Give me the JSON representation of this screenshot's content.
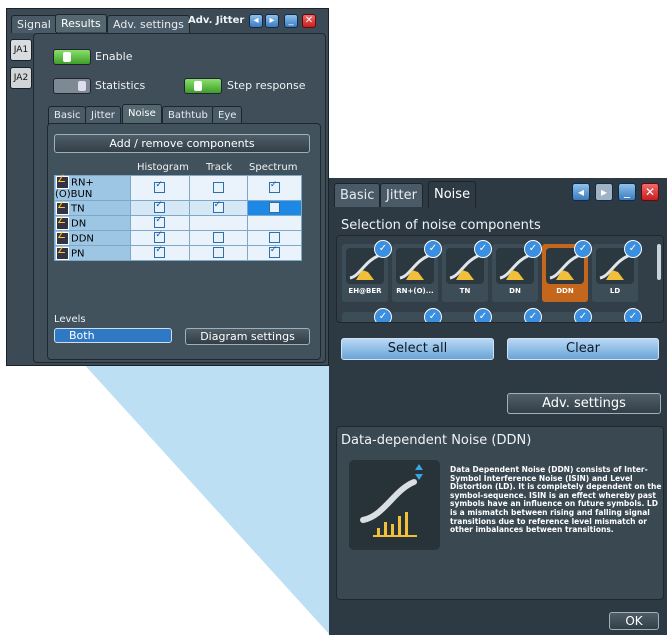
{
  "window": {
    "title": "Adv. Jitter",
    "tabs": [
      "Signal",
      "Results",
      "Adv. settings"
    ],
    "side_tabs": [
      "JA1",
      "JA2"
    ],
    "enable_label": "Enable",
    "statistics_label": "Statistics",
    "step_response_label": "Step response",
    "enable_state": "on",
    "statistics_state": "off",
    "step_response_state": "on",
    "sub_tabs": [
      "Basic",
      "Jitter",
      "Noise",
      "Bathtub",
      "Eye"
    ],
    "add_remove_label": "Add / remove components",
    "columns": [
      "Histogram",
      "Track",
      "Spectrum"
    ],
    "rows": [
      {
        "name": "RN+(O)BUN",
        "histogram": true,
        "track": false,
        "spectrum": true
      },
      {
        "name": "TN",
        "histogram": true,
        "track": true,
        "spectrum": false
      },
      {
        "name": "DN",
        "histogram": true,
        "track": null,
        "spectrum": null
      },
      {
        "name": "DDN",
        "histogram": true,
        "track": false,
        "spectrum": false
      },
      {
        "name": "PN",
        "histogram": true,
        "track": false,
        "spectrum": true
      }
    ],
    "levels_label": "Levels",
    "levels_value": "Both",
    "diagram_settings_label": "Diagram settings"
  },
  "zoom": {
    "tabs": [
      "Basic",
      "Jitter",
      "Noise"
    ],
    "section_title": "Selection of noise components",
    "tiles": [
      {
        "label": "EH@BER",
        "checked": true,
        "selected": false
      },
      {
        "label": "RN+(O)...",
        "checked": true,
        "selected": false
      },
      {
        "label": "TN",
        "checked": true,
        "selected": false
      },
      {
        "label": "DN",
        "checked": true,
        "selected": false
      },
      {
        "label": "DDN",
        "checked": true,
        "selected": true
      },
      {
        "label": "LD",
        "checked": true,
        "selected": false
      }
    ],
    "select_all_label": "Select all",
    "clear_label": "Clear",
    "adv_settings_label": "Adv. settings",
    "info_title": "Data-dependent Noise (DDN)",
    "info_text": "Data Dependent Noise (DDN) consists of Inter-Symbol Interference Noise (ISIN) and Level Distortion (LD). It is completely dependent on the symbol-sequence. ISIN is an effect whereby past symbols have an influence on future symbols. LD is a mismatch between rising and falling signal transitions due to reference level mismatch or other imbalances between transitions.",
    "ok_label": "OK"
  },
  "colors": {
    "accent": "#3b8fe0",
    "selected_tile": "#c4671d",
    "highlight_cell": "#1e88e5"
  }
}
